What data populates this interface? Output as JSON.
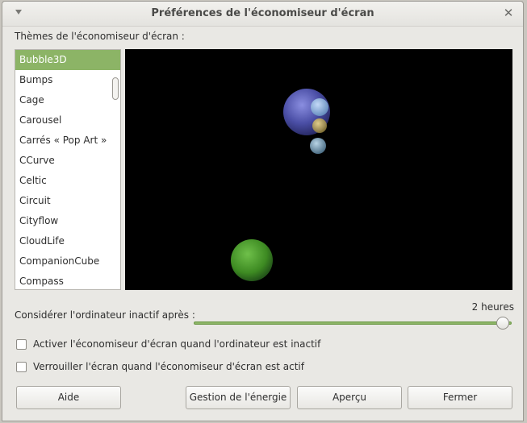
{
  "window": {
    "title": "Préférences de l'économiseur d'écran"
  },
  "icons": {
    "menu": "window-menu-triangle-icon",
    "close": "close-x-icon",
    "close_glyph": "✕"
  },
  "themes": {
    "label": "Thèmes de l'économiseur d'écran :",
    "items": [
      {
        "label": "Bubble3D",
        "selected": true
      },
      {
        "label": "Bumps"
      },
      {
        "label": "Cage"
      },
      {
        "label": "Carousel"
      },
      {
        "label": "Carrés « Pop Art »"
      },
      {
        "label": "CCurve"
      },
      {
        "label": "Celtic"
      },
      {
        "label": "Circuit"
      },
      {
        "label": "Cityflow"
      },
      {
        "label": "CloudLife"
      },
      {
        "label": "CompanionCube"
      },
      {
        "label": "Compass"
      }
    ]
  },
  "idle": {
    "label": "Considérer l'ordinateur inactif après :",
    "value": "2 heures",
    "slider_fraction": 1.0
  },
  "options": {
    "activate": {
      "label": "Activer l'économiseur d'écran quand l'ordinateur est inactif",
      "checked": false
    },
    "lock": {
      "label": "Verrouiller l'écran quand l'économiseur d'écran est actif",
      "checked": false
    }
  },
  "buttons": {
    "help": "Aide",
    "power": "Gestion de l'énergie",
    "preview": "Aperçu",
    "close": "Fermer"
  },
  "colors": {
    "accent": "#8cb466",
    "preview_bg": "#000000"
  }
}
